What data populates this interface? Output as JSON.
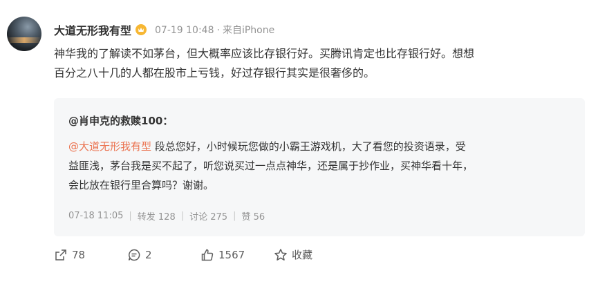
{
  "post": {
    "username": "大道无形我有型",
    "time": "07-19 10:48",
    "source": "来自iPhone",
    "text_line1": "神华我的了解读不如茅台，但大概率应该比存银行好。买腾讯肯定也比存银行好。想想",
    "text_line2": "百分之八十几的人都在股市上亏钱，好过存银行其实是很奢侈的。"
  },
  "repost": {
    "author": "@肖申克的救赎100：",
    "mention": "@大道无形我有型",
    "text_line1": " 段总您好，小时候玩您做的小霸王游戏机，大了看您的投资语录，受",
    "text_line2": "益匪浅，茅台我是买不起了，听您说买过一点点神华，还是属于抄作业，买神华看十年，",
    "text_line3": "会比放在银行里合算吗？谢谢。",
    "time": "07-18 11:05",
    "forward": "转发 128",
    "comment": "讨论 275",
    "like": "赞 56"
  },
  "actions": {
    "share_count": "78",
    "comment_count": "2",
    "like_count": "1567",
    "favorite_label": "收藏"
  },
  "colors": {
    "mention": "#eb7350",
    "vip_badge": "#f7b733",
    "muted": "#939393"
  }
}
